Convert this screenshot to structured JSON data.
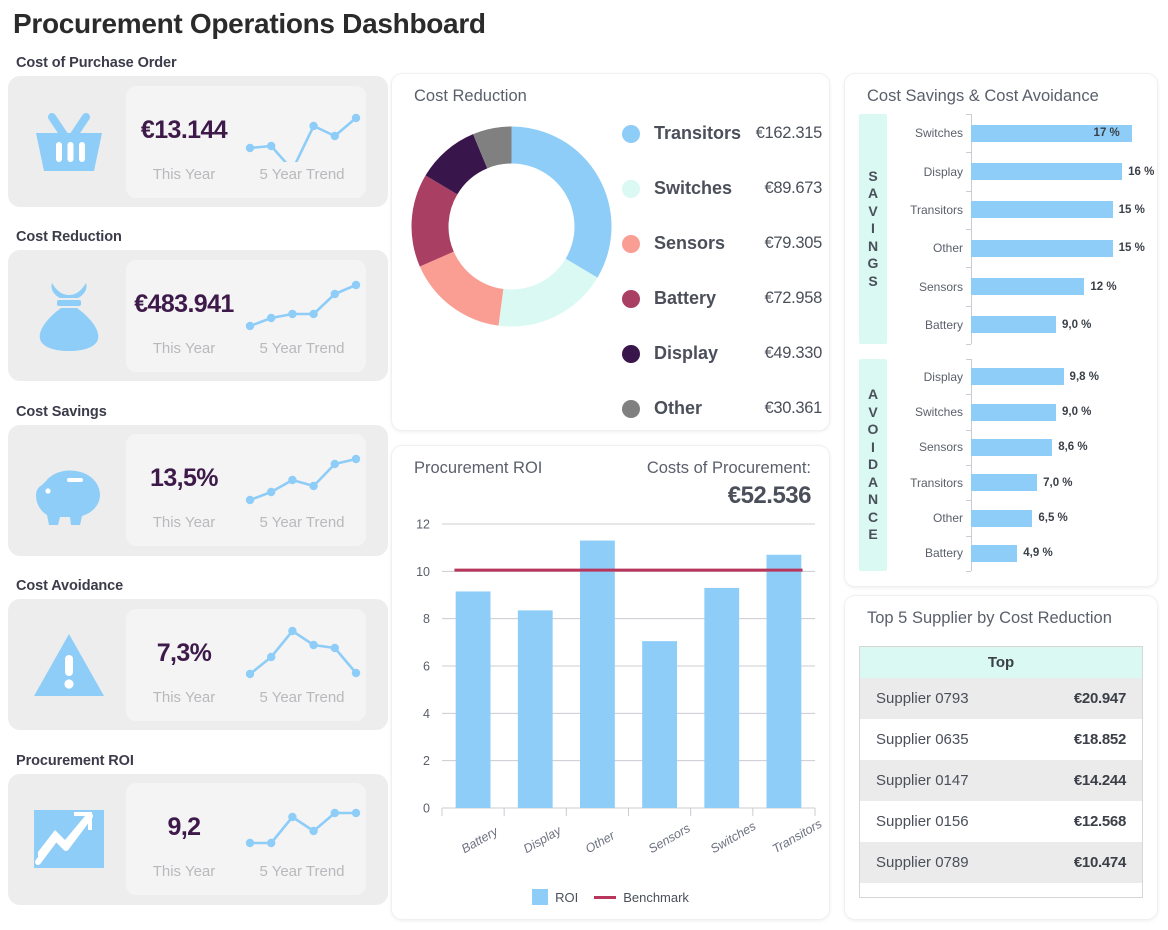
{
  "title": "Procurement Operations Dashboard",
  "colors": {
    "accent_blue": "#8ecdf7",
    "mint": "#d9f9f2",
    "salmon": "#fa9e94",
    "maroon": "#a93f62",
    "purple": "#38154a",
    "gray": "#808080",
    "value_purple": "#3d1a4a"
  },
  "kpis": [
    {
      "label": "Cost of Purchase Order",
      "value": "€13.144",
      "sub_left": "This Year",
      "sub_right": "5 Year Trend",
      "icon": "shopping-basket-icon",
      "trend": [
        52,
        50,
        74,
        30,
        40,
        22
      ]
    },
    {
      "label": "Cost Reduction",
      "value": "€483.941",
      "sub_left": "This Year",
      "sub_right": "5 Year Trend",
      "icon": "money-bag-icon",
      "trend": [
        56,
        48,
        44,
        44,
        24,
        15
      ]
    },
    {
      "label": "Cost Savings",
      "value": "13,5%",
      "sub_left": "This Year",
      "sub_right": "5 Year Trend",
      "icon": "piggy-bank-icon",
      "trend": [
        56,
        48,
        36,
        42,
        20,
        15
      ]
    },
    {
      "label": "Cost Avoidance",
      "value": "7,3%",
      "sub_left": "This Year",
      "sub_right": "5 Year Trend",
      "icon": "warning-triangle-icon",
      "trend": [
        55,
        38,
        12,
        26,
        29,
        54
      ]
    },
    {
      "label": "Procurement ROI",
      "value": "9,2",
      "sub_left": "This Year",
      "sub_right": "5 Year Trend",
      "icon": "chart-up-icon",
      "trend": [
        50,
        50,
        24,
        38,
        20,
        20
      ]
    }
  ],
  "donut_panel": {
    "title": "Cost Reduction"
  },
  "roi_panel": {
    "title": "Procurement ROI",
    "costs_label": "Costs of Procurement:",
    "costs_value": "€52.536"
  },
  "savings_panel": {
    "title": "Cost Savings & Cost Avoidance",
    "savings_band": "SAVINGS",
    "avoidance_band": "AVOIDANCE"
  },
  "supplier_panel": {
    "title": "Top 5 Supplier by Cost Reduction",
    "header": "Top",
    "rows": [
      {
        "name": "Supplier 0793",
        "value": "€20.947"
      },
      {
        "name": "Supplier 0635",
        "value": "€18.852"
      },
      {
        "name": "Supplier 0147",
        "value": "€14.244"
      },
      {
        "name": "Supplier 0156",
        "value": "€12.568"
      },
      {
        "name": "Supplier 0789",
        "value": "€10.474"
      }
    ]
  },
  "chart_data": [
    {
      "id": "cost_reduction_donut",
      "type": "pie",
      "title": "Cost Reduction",
      "donut": true,
      "legend_position": "right",
      "categories": [
        "Transitors",
        "Switches",
        "Sensors",
        "Battery",
        "Display",
        "Other"
      ],
      "values": [
        162315,
        89673,
        79305,
        72958,
        49330,
        30361
      ],
      "value_labels": [
        "€162.315",
        "€89.673",
        "€79.305",
        "€72.958",
        "€49.330",
        "€30.361"
      ],
      "colors": [
        "#8ecdf7",
        "#d9f9f2",
        "#fa9e94",
        "#a93f62",
        "#38154a",
        "#808080"
      ]
    },
    {
      "id": "procurement_roi_bar",
      "type": "bar",
      "title": "Procurement ROI",
      "xlabel": "",
      "ylabel": "",
      "ylim": [
        0,
        12
      ],
      "yticks": [
        0,
        2,
        4,
        6,
        8,
        10,
        12
      ],
      "grid": true,
      "categories": [
        "Battery",
        "Display",
        "Other",
        "Sensors",
        "Switches",
        "Transitors"
      ],
      "series": [
        {
          "name": "ROI",
          "values": [
            9.15,
            8.35,
            11.3,
            7.05,
            9.3,
            10.7
          ],
          "color": "#8ecdf7"
        }
      ],
      "benchmark": {
        "name": "Benchmark",
        "value": 10.05,
        "color": "#b8365c"
      },
      "legend": [
        "ROI",
        "Benchmark"
      ]
    },
    {
      "id": "cost_savings_hbar",
      "type": "bar",
      "orientation": "horizontal",
      "title": "SAVINGS",
      "xlim": [
        0,
        18
      ],
      "categories": [
        "Switches",
        "Display",
        "Transitors",
        "Other",
        "Sensors",
        "Battery"
      ],
      "values": [
        17,
        16,
        15,
        15,
        12,
        9.0
      ],
      "value_labels": [
        "17 %",
        "16 %",
        "15 %",
        "15 %",
        "12 %",
        "9,0 %"
      ],
      "color": "#8ecdf7"
    },
    {
      "id": "cost_avoidance_hbar",
      "type": "bar",
      "orientation": "horizontal",
      "title": "AVOIDANCE",
      "xlim": [
        0,
        18
      ],
      "categories": [
        "Display",
        "Switches",
        "Sensors",
        "Transitors",
        "Other",
        "Battery"
      ],
      "values": [
        9.8,
        9.0,
        8.6,
        7.0,
        6.5,
        4.9
      ],
      "value_labels": [
        "9,8 %",
        "9,0 %",
        "8,6 %",
        "7,0 %",
        "6,5 %",
        "4,9 %"
      ],
      "color": "#8ecdf7"
    },
    {
      "id": "top_supplier_table",
      "type": "table",
      "title": "Top 5 Supplier by Cost Reduction",
      "columns": [
        "Top",
        ""
      ],
      "rows": [
        [
          "Supplier 0793",
          "€20.947"
        ],
        [
          "Supplier 0635",
          "€18.852"
        ],
        [
          "Supplier 0147",
          "€14.244"
        ],
        [
          "Supplier 0156",
          "€12.568"
        ],
        [
          "Supplier 0789",
          "€10.474"
        ]
      ]
    }
  ]
}
